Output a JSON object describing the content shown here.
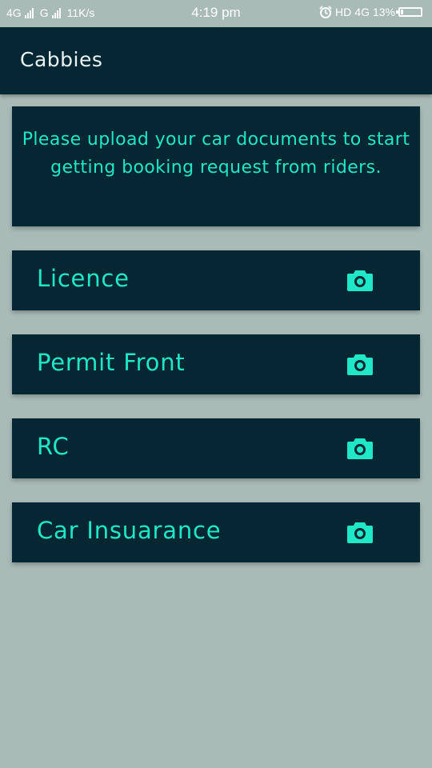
{
  "status_bar": {
    "network1": "4G",
    "network2": "G",
    "speed": "11K/s",
    "time": "4:19 pm",
    "hd": "HD",
    "network3": "4G",
    "battery": "13%",
    "battery_level": 0.13
  },
  "app_bar": {
    "title": "Cabbies"
  },
  "notice": {
    "text": "Please upload your car documents to start getting booking request from riders."
  },
  "documents": [
    {
      "label": "Licence",
      "icon": "camera-icon"
    },
    {
      "label": "Permit Front",
      "icon": "camera-icon"
    },
    {
      "label": "RC",
      "icon": "camera-icon"
    },
    {
      "label": "Car Insuarance",
      "icon": "camera-icon"
    }
  ],
  "colors": {
    "background": "#a9bbb7",
    "card": "#042733",
    "accent": "#1ee8c6"
  }
}
